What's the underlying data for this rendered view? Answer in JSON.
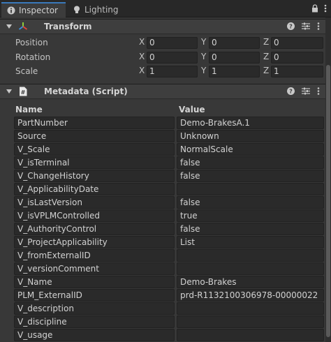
{
  "tabs": [
    {
      "label": "Inspector",
      "icon": "info-icon"
    },
    {
      "label": "Lighting",
      "icon": "lightbulb-icon"
    }
  ],
  "transform": {
    "title": "Transform",
    "rows": [
      {
        "label": "Position",
        "x": "0",
        "y": "0",
        "z": "0"
      },
      {
        "label": "Rotation",
        "x": "0",
        "y": "0",
        "z": "0"
      },
      {
        "label": "Scale",
        "x": "1",
        "y": "1",
        "z": "1"
      }
    ],
    "axes": {
      "x": "X",
      "y": "Y",
      "z": "Z"
    }
  },
  "metadata": {
    "title": "Metadata (Script)",
    "col_name": "Name",
    "col_value": "Value",
    "rows": [
      {
        "name": "PartNumber",
        "value": "Demo-BrakesA.1"
      },
      {
        "name": "Source",
        "value": "Unknown"
      },
      {
        "name": "V_Scale",
        "value": "NormalScale"
      },
      {
        "name": "V_isTerminal",
        "value": "false"
      },
      {
        "name": "V_ChangeHistory",
        "value": "false"
      },
      {
        "name": "V_ApplicabilityDate",
        "value": ""
      },
      {
        "name": "V_isLastVersion",
        "value": "false"
      },
      {
        "name": "V_isVPLMControlled",
        "value": "true"
      },
      {
        "name": "V_AuthorityControl",
        "value": "false"
      },
      {
        "name": "V_ProjectApplicability",
        "value": "List"
      },
      {
        "name": "V_fromExternalID",
        "value": ""
      },
      {
        "name": "V_versionComment",
        "value": ""
      },
      {
        "name": "V_Name",
        "value": "Demo-Brakes"
      },
      {
        "name": "PLM_ExternalID",
        "value": "prd-R1132100306978-00000022"
      },
      {
        "name": "V_description",
        "value": ""
      },
      {
        "name": "V_discipline",
        "value": ""
      },
      {
        "name": "V_usage",
        "value": ""
      }
    ]
  },
  "colors": {
    "accent": "#3a79bb",
    "panel": "#383838",
    "field": "#2a2a2a"
  }
}
